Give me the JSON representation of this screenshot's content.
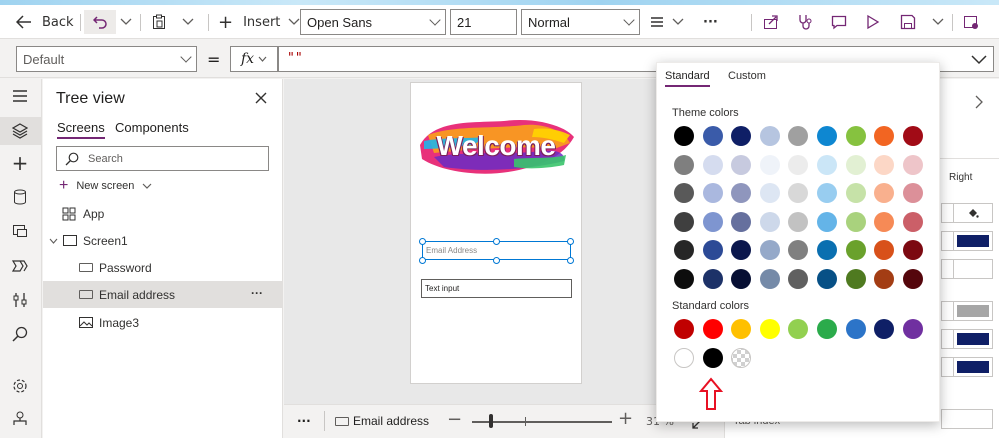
{
  "toolbar": {
    "back_label": "Back",
    "insert_label": "Insert",
    "font_value": "Open Sans",
    "size_value": "21",
    "weight_value": "Normal",
    "more_label": "···"
  },
  "formula": {
    "property_value": "Default",
    "equals": "=",
    "fx_label": "fx",
    "formula_text": "\"\""
  },
  "tree": {
    "title": "Tree view",
    "tab_screens": "Screens",
    "tab_components": "Components",
    "search_placeholder": "Search",
    "new_screen_label": "New screen",
    "items": [
      {
        "label": "App"
      },
      {
        "label": "Screen1"
      },
      {
        "label": "Password"
      },
      {
        "label": "Email address"
      },
      {
        "label": "Image3"
      }
    ],
    "more_dots": "···"
  },
  "canvas": {
    "welcome_text": "Welcome",
    "email_placeholder": "Email Address",
    "text_input_value": "Text input"
  },
  "statusbar": {
    "dots": "···",
    "selected_label": "Email address",
    "zoom_partial": "31 %"
  },
  "rightpane": {
    "right_label": "Right",
    "tab_index_partial": "Tab index"
  },
  "color_picker": {
    "tab_standard": "Standard",
    "tab_custom": "Custom",
    "theme_heading": "Theme colors",
    "standard_heading": "Standard colors",
    "theme_rows": [
      [
        "#000000",
        "#3a5ba9",
        "#0f1f66",
        "#b6c5e0",
        "#a0a0a0",
        "#0e87d1",
        "#86c23f",
        "#f26522",
        "#a10b16"
      ],
      [
        "#7f7f7f",
        "#d5dcef",
        "#c7cadf",
        "#eff3f9",
        "#ececec",
        "#cbe6f7",
        "#e2f0d3",
        "#fcd7c6",
        "#eec5c9"
      ],
      [
        "#595959",
        "#aab8df",
        "#8f96bd",
        "#dde6f3",
        "#d8d8d8",
        "#98cdf0",
        "#c6e2a8",
        "#f9b08e",
        "#dc9099"
      ],
      [
        "#3f3f3f",
        "#7e95d0",
        "#66709e",
        "#cdd8ea",
        "#c2c2c2",
        "#64b4e8",
        "#a9d27d",
        "#f68a56",
        "#cb5f68"
      ],
      [
        "#262626",
        "#2c4a96",
        "#0b174d",
        "#95a9c9",
        "#808080",
        "#0a6fb0",
        "#6aa12c",
        "#d8511a",
        "#7c0911"
      ],
      [
        "#0d0d0d",
        "#1d3268",
        "#070f33",
        "#758aa8",
        "#606060",
        "#075086",
        "#4f7a20",
        "#a33d14",
        "#55060c"
      ]
    ],
    "standard_rows": [
      [
        "#c00000",
        "#ff0000",
        "#ffc000",
        "#ffff00",
        "#92d050",
        "#2bab4b",
        "#2c74c8",
        "#0f1f66",
        "#7030a0"
      ],
      [
        "#ffffff",
        "#000000",
        "transparent"
      ]
    ]
  },
  "colors": {
    "accent": "#742774",
    "selection_blue": "#0078d4",
    "arrow_red": "#e81123",
    "navy": "#0f1f66"
  }
}
